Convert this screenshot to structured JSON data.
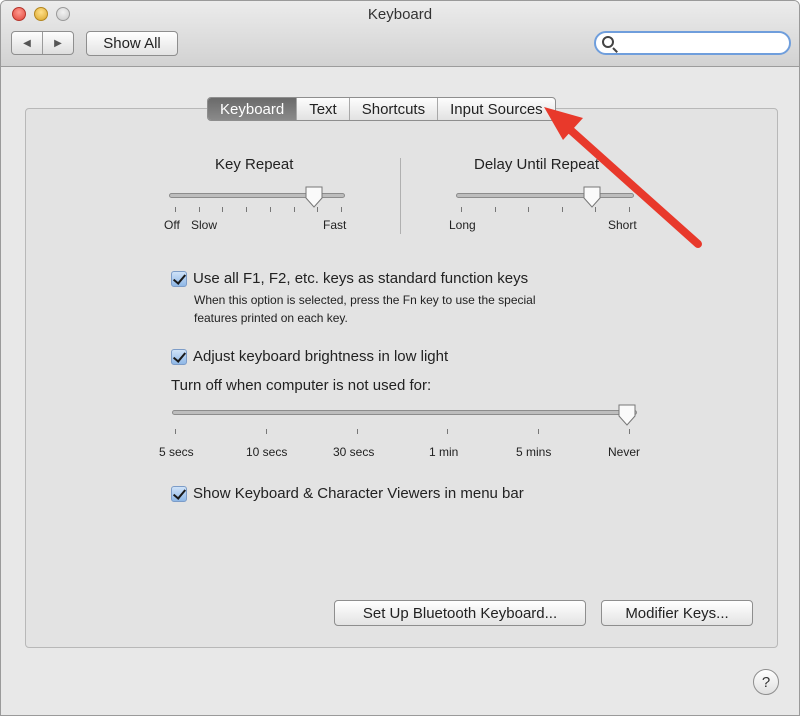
{
  "window": {
    "title": "Keyboard"
  },
  "toolbar": {
    "back_icon": "back-arrow-icon",
    "forward_icon": "forward-arrow-icon",
    "show_all_label": "Show All",
    "search": {
      "value": "",
      "placeholder": ""
    }
  },
  "tabs": [
    {
      "label": "Keyboard",
      "active": true
    },
    {
      "label": "Text",
      "active": false
    },
    {
      "label": "Shortcuts",
      "active": false
    },
    {
      "label": "Input Sources",
      "active": false
    }
  ],
  "key_repeat": {
    "title": "Key Repeat",
    "labels": {
      "off": "Off",
      "slow": "Slow",
      "fast": "Fast"
    },
    "level": 0.82
  },
  "delay_until_repeat": {
    "title": "Delay Until Repeat",
    "labels": {
      "long": "Long",
      "short": "Short"
    },
    "level": 0.75
  },
  "function_keys": {
    "checked": true,
    "label": "Use all F1, F2, etc. keys as standard function keys",
    "description_line1": "When this option is selected, press the Fn key to use the special",
    "description_line2": "features printed on each key."
  },
  "brightness": {
    "checked": true,
    "label": "Adjust keyboard brightness in low light",
    "turn_off_label": "Turn off when computer is not used for:",
    "ticks": [
      "5 secs",
      "10 secs",
      "30 secs",
      "1 min",
      "5 mins",
      "Never"
    ],
    "level": 1.0
  },
  "viewers": {
    "checked": true,
    "label": "Show Keyboard & Character Viewers in menu bar"
  },
  "buttons": {
    "bluetooth": "Set Up Bluetooth Keyboard...",
    "modifier": "Modifier Keys..."
  },
  "help_label": "?",
  "annotation": {
    "color": "#e8392b"
  }
}
